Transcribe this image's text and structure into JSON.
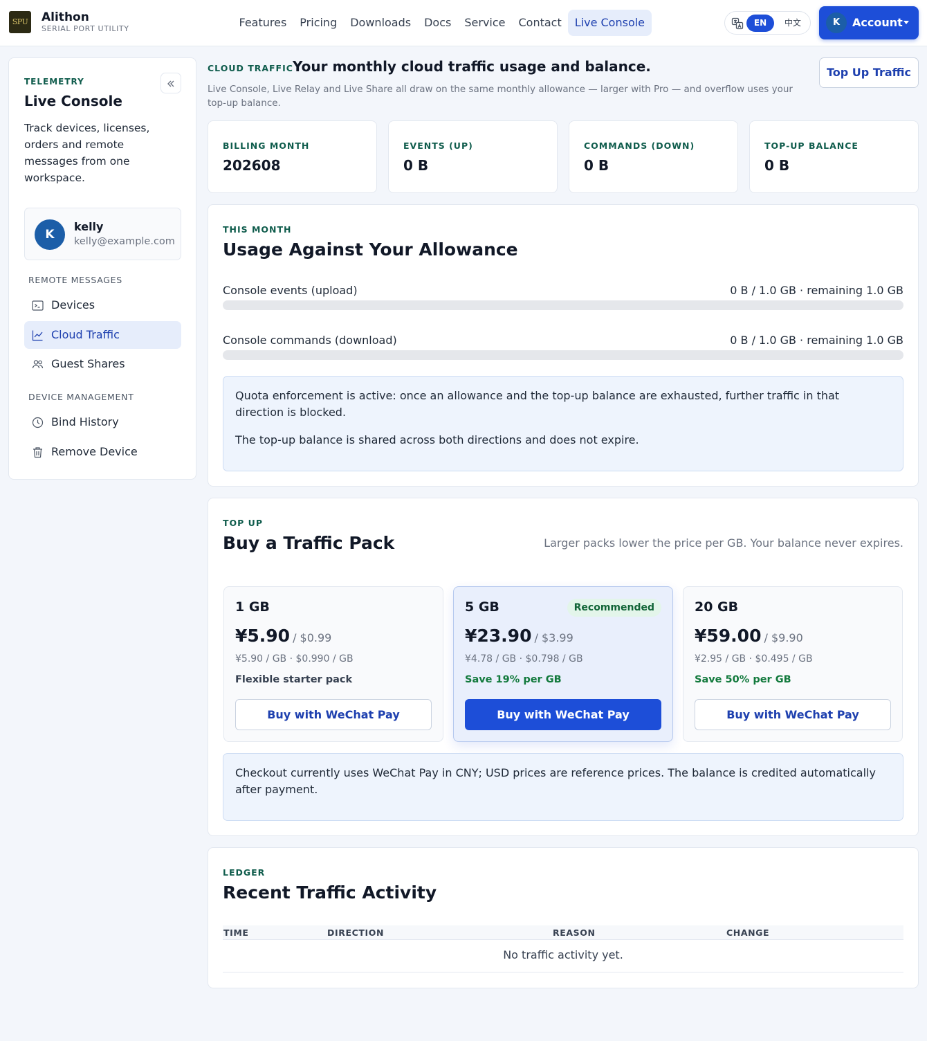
{
  "header": {
    "brand": "Alithon",
    "brand_sub": "SERIAL PORT UTILITY",
    "logo_text": "SPU",
    "nav": [
      "Features",
      "Pricing",
      "Downloads",
      "Docs",
      "Service",
      "Contact",
      "Live Console"
    ],
    "active_nav": "Live Console",
    "lang": {
      "en": "EN",
      "zh": "中文",
      "selected": "EN"
    },
    "account": {
      "initial": "K",
      "label": "Account"
    }
  },
  "sidebar": {
    "eyebrow": "TELEMETRY",
    "title": "Live Console",
    "description": "Track devices, licenses, orders and remote messages from one workspace.",
    "user": {
      "initial": "K",
      "name": "kelly",
      "email": "kelly@example.com"
    },
    "groups": [
      {
        "label": "REMOTE MESSAGES",
        "items": [
          {
            "label": "Devices",
            "icon": "terminal-icon"
          },
          {
            "label": "Cloud Traffic",
            "icon": "chart-line-icon",
            "active": true
          },
          {
            "label": "Guest Shares",
            "icon": "users-icon"
          }
        ]
      },
      {
        "label": "DEVICE MANAGEMENT",
        "items": [
          {
            "label": "Bind History",
            "icon": "clock-icon"
          },
          {
            "label": "Remove Device",
            "icon": "trash-icon"
          }
        ]
      }
    ]
  },
  "page": {
    "eyebrow": "CLOUD TRAFFIC",
    "heading": "Your monthly cloud traffic usage and balance.",
    "description": "Live Console, Live Relay and Live Share all draw on the same monthly allowance — larger with Pro — and overflow uses your top-up balance.",
    "topup_button": "Top Up Traffic"
  },
  "stats": [
    {
      "label": "BILLING MONTH",
      "value": "202608"
    },
    {
      "label": "EVENTS (UP)",
      "value": "0 B"
    },
    {
      "label": "COMMANDS (DOWN)",
      "value": "0 B"
    },
    {
      "label": "TOP-UP BALANCE",
      "value": "0 B"
    }
  ],
  "usage": {
    "eyebrow": "THIS MONTH",
    "title": "Usage Against Your Allowance",
    "rows": [
      {
        "label": "Console events (upload)",
        "value": "0 B / 1.0 GB · remaining 1.0 GB",
        "fraction": 0
      },
      {
        "label": "Console commands (download)",
        "value": "0 B / 1.0 GB · remaining 1.0 GB",
        "fraction": 0
      }
    ],
    "notes": [
      "Quota enforcement is active: once an allowance and the top-up balance are exhausted, further traffic in that direction is blocked.",
      "The top-up balance is shared across both directions and does not expire."
    ]
  },
  "buy": {
    "eyebrow": "TOP UP",
    "title": "Buy a Traffic Pack",
    "note": "Larger packs lower the price per GB. Your balance never expires.",
    "packs": [
      {
        "size": "1 GB",
        "cny": "¥5.90",
        "usd": "/ $0.99",
        "unit": "¥5.90 / GB · $0.990 / GB",
        "note": "Flexible starter pack",
        "save": false,
        "badge": "",
        "button": "Buy with WeChat Pay",
        "featured": false
      },
      {
        "size": "5 GB",
        "cny": "¥23.90",
        "usd": "/ $3.99",
        "unit": "¥4.78 / GB · $0.798 / GB",
        "note": "Save 19% per GB",
        "save": true,
        "badge": "Recommended",
        "button": "Buy with WeChat Pay",
        "featured": true
      },
      {
        "size": "20 GB",
        "cny": "¥59.00",
        "usd": "/ $9.90",
        "unit": "¥2.95 / GB · $0.495 / GB",
        "note": "Save 50% per GB",
        "save": true,
        "badge": "",
        "button": "Buy with WeChat Pay",
        "featured": false
      }
    ],
    "checkout_note": "Checkout currently uses WeChat Pay in CNY; USD prices are reference prices. The balance is credited automatically after payment."
  },
  "ledger": {
    "eyebrow": "LEDGER",
    "title": "Recent Traffic Activity",
    "columns": [
      "TIME",
      "DIRECTION",
      "REASON",
      "CHANGE"
    ],
    "empty": "No traffic activity yet."
  }
}
